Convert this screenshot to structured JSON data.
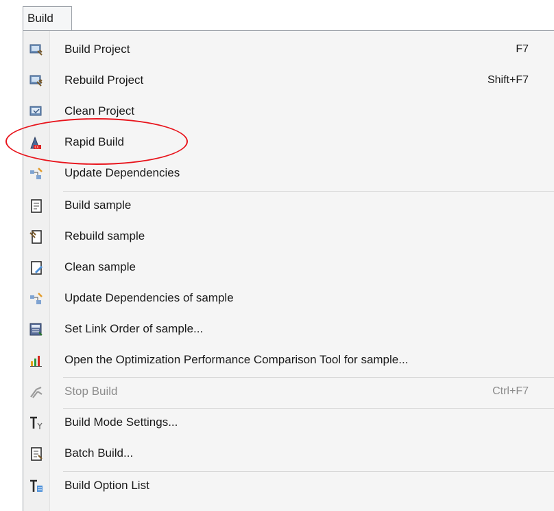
{
  "menu_title": "Build",
  "items": [
    {
      "label": "Build Project",
      "shortcut": "F7",
      "icon": "build-project-icon"
    },
    {
      "label": "Rebuild Project",
      "shortcut": "Shift+F7",
      "icon": "rebuild-project-icon"
    },
    {
      "label": "Clean Project",
      "shortcut": "",
      "icon": "clean-project-icon"
    },
    {
      "label": "Rapid Build",
      "shortcut": "",
      "icon": "rapid-build-icon"
    },
    {
      "label": "Update Dependencies",
      "shortcut": "",
      "icon": "update-dependencies-icon"
    },
    {
      "label": "Build sample",
      "shortcut": "",
      "icon": "build-sample-icon"
    },
    {
      "label": "Rebuild sample",
      "shortcut": "",
      "icon": "rebuild-sample-icon"
    },
    {
      "label": "Clean sample",
      "shortcut": "",
      "icon": "clean-sample-icon"
    },
    {
      "label": "Update Dependencies of sample",
      "shortcut": "",
      "icon": "update-dependencies-sample-icon"
    },
    {
      "label": "Set Link Order of sample...",
      "shortcut": "",
      "icon": "link-order-icon"
    },
    {
      "label": "Open the Optimization Performance Comparison Tool for sample...",
      "shortcut": "",
      "icon": "bar-chart-icon"
    },
    {
      "label": "Stop Build",
      "shortcut": "Ctrl+F7",
      "icon": "stop-build-icon",
      "disabled": true
    },
    {
      "label": "Build Mode Settings...",
      "shortcut": "",
      "icon": "build-mode-icon"
    },
    {
      "label": "Batch Build...",
      "shortcut": "",
      "icon": "batch-build-icon"
    },
    {
      "label": "Build Option List",
      "shortcut": "",
      "icon": "build-option-list-icon"
    }
  ],
  "colors": {
    "highlight_ring": "#e8141c",
    "disabled_text": "#8c8c8c"
  }
}
